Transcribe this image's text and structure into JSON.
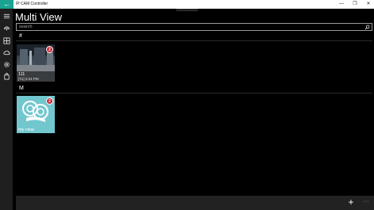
{
  "window": {
    "app_title": "IP CAM Controller",
    "back_glyph": "←",
    "minimize_glyph": "—",
    "maximize_glyph": "❐",
    "close_glyph": "✕"
  },
  "nav": {
    "menu_icon": "hamburger-menu-icon",
    "items": [
      {
        "icon": "wireless-camera-icon"
      },
      {
        "icon": "grid-view-icon"
      },
      {
        "icon": "cloud-icon"
      },
      {
        "icon": "settings-gear-icon"
      },
      {
        "icon": "store-bag-icon"
      }
    ]
  },
  "header": {
    "title": "Multi View",
    "search_placeholder": "search"
  },
  "groups": [
    {
      "letter": "#",
      "tiles": [
        {
          "name": "111",
          "time": "[Tu] 3:24 PM",
          "badge": "2"
        }
      ]
    },
    {
      "letter": "M",
      "tiles": [
        {
          "name": "my view",
          "badge": "2"
        }
      ]
    }
  ],
  "bottom_bar": {
    "add_glyph": "+",
    "more_glyph": "···"
  },
  "colors": {
    "accent": "#1aa392",
    "badge": "#d0202c",
    "placeholder_tile": "#72c7cf"
  }
}
